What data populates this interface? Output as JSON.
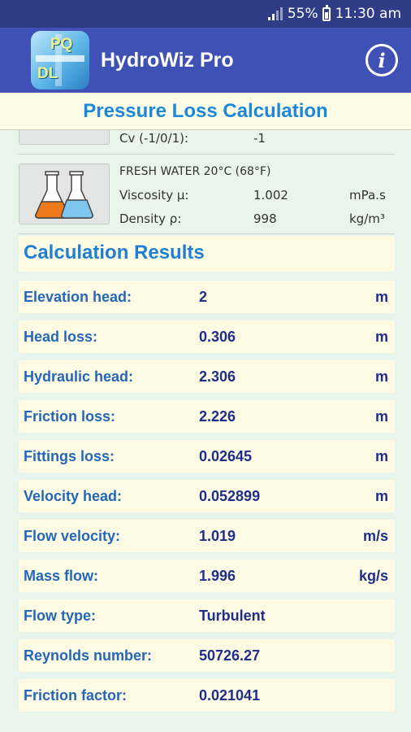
{
  "status": {
    "battery": "55%",
    "time": "11:30 am"
  },
  "app": {
    "title": "HydroWiz Pro",
    "logo_letters": [
      "PQ",
      "DL"
    ]
  },
  "header": {
    "title": "Pressure Loss Calculation"
  },
  "valve": {
    "label": "Cv (-1/0/1):",
    "value": "-1"
  },
  "fluid": {
    "name": "FRESH WATER 20°C (68°F)",
    "viscosity_label": "Viscosity μ:",
    "viscosity_value": "1.002",
    "viscosity_unit": "mPa.s",
    "density_label": "Density ρ:",
    "density_value": "998",
    "density_unit": "kg/m³"
  },
  "results": {
    "title": "Calculation Results",
    "rows": [
      {
        "label": "Elevation head:",
        "value": "2",
        "unit": "m"
      },
      {
        "label": "Head loss:",
        "value": "0.306",
        "unit": "m"
      },
      {
        "label": "Hydraulic head:",
        "value": "2.306",
        "unit": "m"
      },
      {
        "label": "Friction loss:",
        "value": "2.226",
        "unit": "m"
      },
      {
        "label": "Fittings loss:",
        "value": "0.02645",
        "unit": "m"
      },
      {
        "label": "Velocity head:",
        "value": "0.052899",
        "unit": "m"
      },
      {
        "label": "Flow velocity:",
        "value": "1.019",
        "unit": "m/s"
      },
      {
        "label": "Mass flow:",
        "value": "1.996",
        "unit": "kg/s"
      },
      {
        "label": "Flow type:",
        "value": "Turbulent",
        "unit": ""
      },
      {
        "label": "Reynolds number:",
        "value": "50726.27",
        "unit": ""
      },
      {
        "label": "Friction factor:",
        "value": "0.021041",
        "unit": ""
      }
    ]
  },
  "colors": {
    "appbar": "#3f51b5",
    "statusbar": "#2f3d86",
    "accent": "#1e88d8",
    "card": "#fdfbe3",
    "background": "#e9f4ec"
  },
  "icons": {
    "signal": "signal-icon",
    "battery": "battery-icon",
    "info": "info-icon",
    "flasks": "flasks-icon"
  }
}
